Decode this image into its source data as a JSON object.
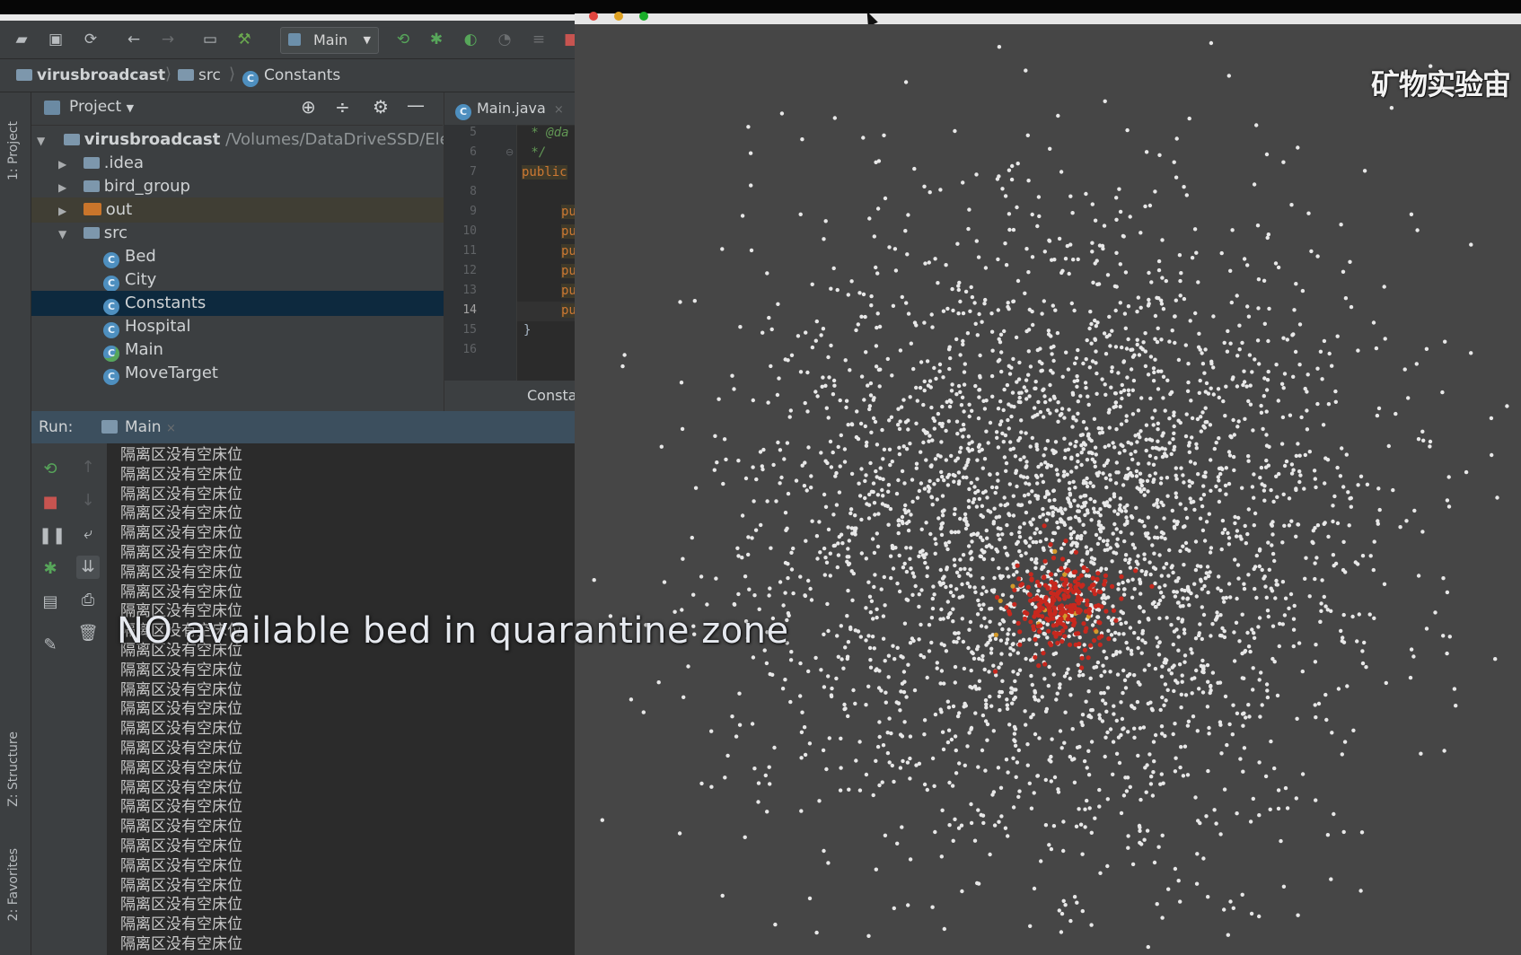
{
  "ide": {
    "run_config": "Main",
    "breadcrumb": [
      "virusbroadcast",
      "src",
      "Constants"
    ],
    "side_tabs": {
      "project": "1: Project",
      "structure": "Z: Structure",
      "favorites": "2: Favorites"
    },
    "project_panel": {
      "title": "Project",
      "root_name": "virusbroadcast",
      "root_path": "/Volumes/DataDriveSSD/Ele",
      "folders": [
        ".idea",
        "bird_group",
        "out",
        "src"
      ],
      "classes": [
        "Bed",
        "City",
        "Constants",
        "Hospital",
        "Main",
        "MoveTarget"
      ],
      "selected": "Constants"
    },
    "editor": {
      "tab_label": "Main.java",
      "line_numbers": [
        "5",
        "6",
        "7",
        "8",
        "9",
        "10",
        "11",
        "12",
        "13",
        "14",
        "15",
        "16"
      ],
      "current_line": "14",
      "code": {
        "line5": " * @da",
        "line6": " */",
        "line7": "public",
        "pu": "pu",
        "close_brace": "}"
      },
      "footer_label": "Consta"
    },
    "run": {
      "label": "Run:",
      "tab_label": "Main",
      "console_message": "隔离区没有空床位",
      "console_line_count": 26
    }
  },
  "simulation": {
    "watermark": "矿物实验宙",
    "colors": {
      "background": "#464646",
      "healthy": "#e8e8e8",
      "infected": "#c8281e",
      "infected_accent": "#d49a2a"
    }
  },
  "subtitle": "NO available bed in quarantine zone",
  "colors": {
    "ide_bg": "#3c3f41",
    "editor_bg": "#2b2b2b",
    "selection": "#0d293e",
    "run_header": "#3c4f5e"
  }
}
